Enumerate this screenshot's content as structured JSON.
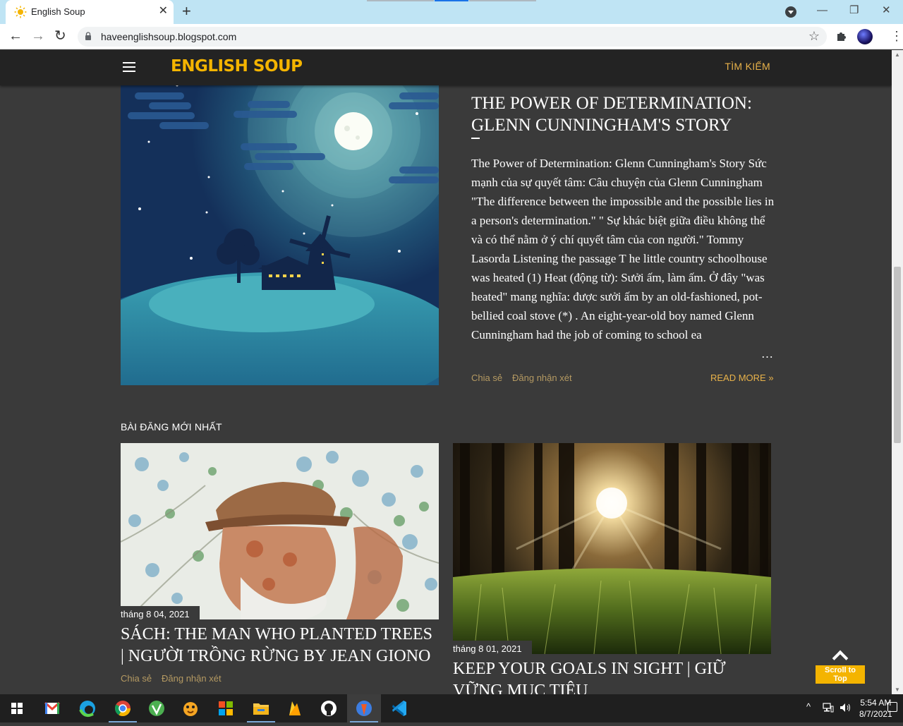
{
  "browser": {
    "tab_title": "English Soup",
    "new_tab_symbol": "+",
    "close_symbol": "✕",
    "url": "haveenglishsoup.blogspot.com",
    "back_symbol": "←",
    "forward_symbol": "→",
    "reload_symbol": "↻",
    "star_symbol": "☆",
    "minimize_symbol": "—",
    "restore_symbol": "❐",
    "window_close_symbol": "✕"
  },
  "site": {
    "logo": "ENGLISH SOUP",
    "search_label": "TÌM KIẾM"
  },
  "featured": {
    "title": "THE POWER OF DETERMINATION: GLENN CUNNINGHAM'S STORY",
    "snippet": "The Power of Determination: Glenn Cunningham's Story Sức mạnh của sự quyết tâm: Câu chuyện của Glenn Cunningham \"The difference between the impossible and the possible lies in a person's determination.\" \" Sự khác biệt giữa điều không thể và có thể nằm ở ý chí quyết tâm của con người.\" Tommy Lasorda Listening the passage      T he little country schoolhouse was heated (1) Heat (động từ): Sưởi ấm, làm ấm. Ở đây \"was heated\" mang nghĩa: được sưởi ấm by an old-fashioned, pot-bellied coal stove (*) . An eight-year-old boy named Glenn Cunningham had the job of coming to school ea",
    "ellipsis": "…",
    "share": "Chia sẻ",
    "comment": "Đăng nhận xét",
    "read_more": "READ MORE »"
  },
  "latest": {
    "heading": "BÀI ĐĂNG MỚI NHẤT",
    "posts": [
      {
        "date": "tháng 8 04, 2021",
        "title": "SÁCH: THE MAN WHO PLANTED TREES | NGƯỜI TRỒNG RỪNG BY JEAN GIONO",
        "share": "Chia sẻ",
        "comment": "Đăng nhận xét"
      },
      {
        "date": "tháng 8 01, 2021",
        "title": "KEEP YOUR GOALS IN SIGHT | GIỮ VỮNG MỤC TIÊU"
      }
    ]
  },
  "scroll_top": {
    "label": "Scroll to Top"
  },
  "taskbar": {
    "time": "5:54 AM",
    "date": "8/7/2021",
    "apps": [
      "start-icon",
      "gmail-icon",
      "edge-icon",
      "chrome-icon",
      "vine-app-icon",
      "duck-app-icon",
      "office-icon",
      "file-explorer-icon",
      "firebase-icon",
      "github-icon",
      "postman-icon",
      "vscode-icon"
    ]
  },
  "colors": {
    "accent": "#f4b400",
    "link": "#b59a62",
    "page_bg": "#3a3a3a",
    "header_bg": "#232323"
  }
}
